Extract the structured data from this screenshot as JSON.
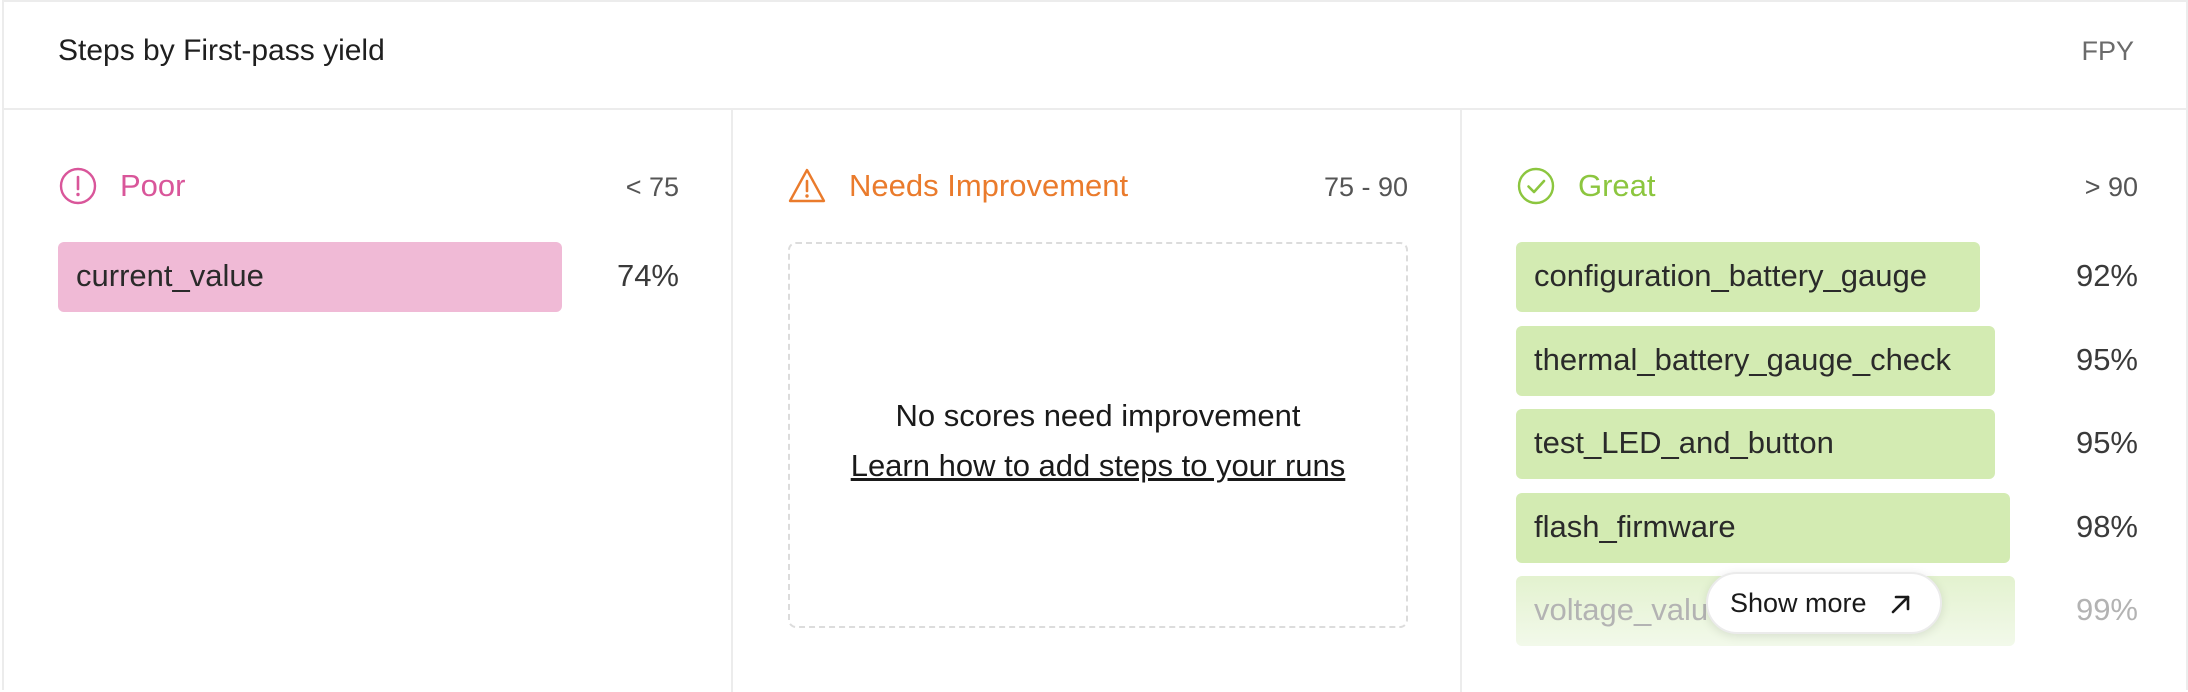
{
  "header": {
    "title": "Steps by First-pass yield",
    "unit": "FPY"
  },
  "columns": {
    "poor": {
      "label": "Poor",
      "range": "< 75",
      "icon": "alert-circle-icon",
      "color": "#d9569a",
      "items": [
        {
          "name": "current_value",
          "value": "74%",
          "fpy": 74
        }
      ]
    },
    "needs": {
      "label": "Needs Improvement",
      "range": "75 - 90",
      "icon": "warning-triangle-icon",
      "color": "#ea7b2c",
      "empty_title": "No scores need improvement",
      "empty_link": "Learn how to add steps to your runs"
    },
    "great": {
      "label": "Great",
      "range": "> 90",
      "icon": "check-circle-icon",
      "color": "#8cc63f",
      "items": [
        {
          "name": "configuration_battery_gauge",
          "value": "92%",
          "fpy": 92
        },
        {
          "name": "thermal_battery_gauge_check",
          "value": "95%",
          "fpy": 95
        },
        {
          "name": "test_LED_and_button",
          "value": "95%",
          "fpy": 95
        },
        {
          "name": "flash_firmware",
          "value": "98%",
          "fpy": 98
        },
        {
          "name": "voltage_value",
          "value": "99%",
          "fpy": 99
        }
      ]
    }
  },
  "show_more": {
    "label": "Show more",
    "icon": "arrow-up-right-icon"
  }
}
